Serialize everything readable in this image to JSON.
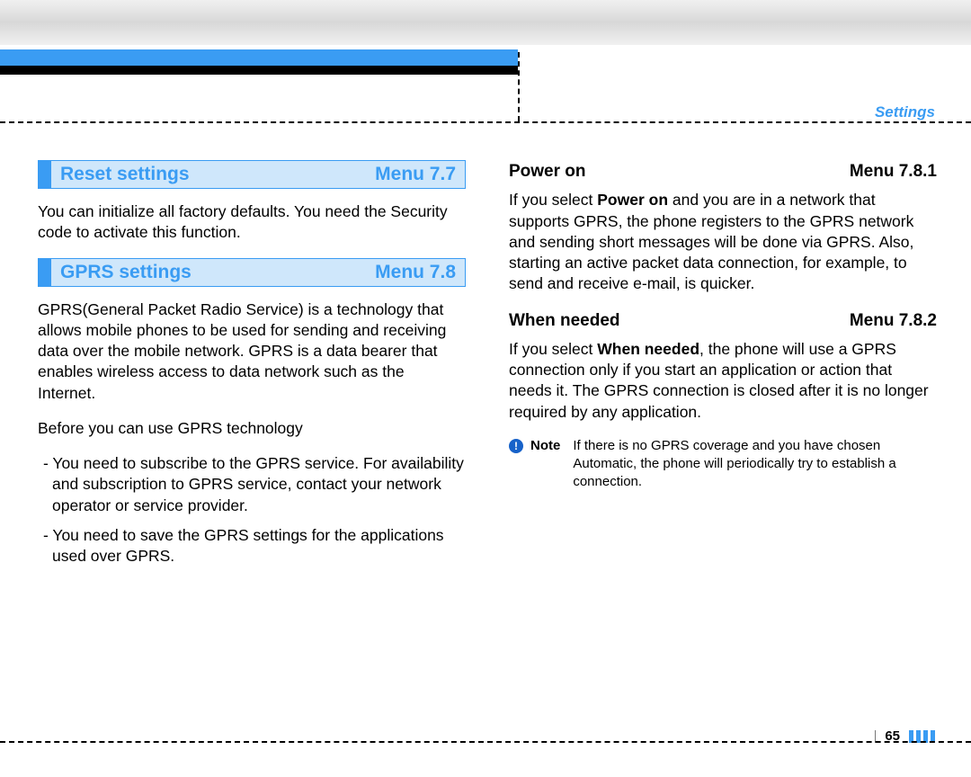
{
  "header": {
    "section_label": "Settings"
  },
  "left_col": {
    "reset": {
      "title": "Reset settings",
      "menu": "Menu 7.7",
      "body": "You can initialize all factory defaults. You need the Security code to activate this function."
    },
    "gprs": {
      "title": "GPRS settings",
      "menu": "Menu 7.8",
      "p1": "GPRS(General Packet Radio Service) is a technology that allows mobile phones to be used for sending and receiving data over the mobile network. GPRS is a data bearer that enables wireless access to data network such as the Internet.",
      "p2": "Before you can use GPRS technology",
      "bullets": [
        "- You need to subscribe to the GPRS service. For availability and subscription to GPRS service, contact your network operator or service provider.",
        "- You need to save the GPRS settings for the applications used over GPRS."
      ]
    }
  },
  "right_col": {
    "power_on": {
      "title": "Power on",
      "menu": "Menu 7.8.1",
      "body_pre": "If you select ",
      "body_bold": "Power on",
      "body_post": " and you are in a network that supports GPRS, the phone registers to the GPRS network and sending short messages will be done via GPRS. Also, starting an active packet data connection, for example, to send and receive e-mail, is quicker."
    },
    "when_needed": {
      "title": "When needed",
      "menu": "Menu 7.8.2",
      "body_pre": "If you select ",
      "body_bold": "When needed",
      "body_post": ", the phone will use a GPRS connection only if you start an application or action that needs it. The GPRS connection is closed after it is no longer required by any application."
    },
    "note": {
      "label": "Note",
      "body": "If there is no GPRS coverage and you have chosen Automatic, the phone will periodically try to establish a connection."
    }
  },
  "footer": {
    "page_number": "65"
  }
}
